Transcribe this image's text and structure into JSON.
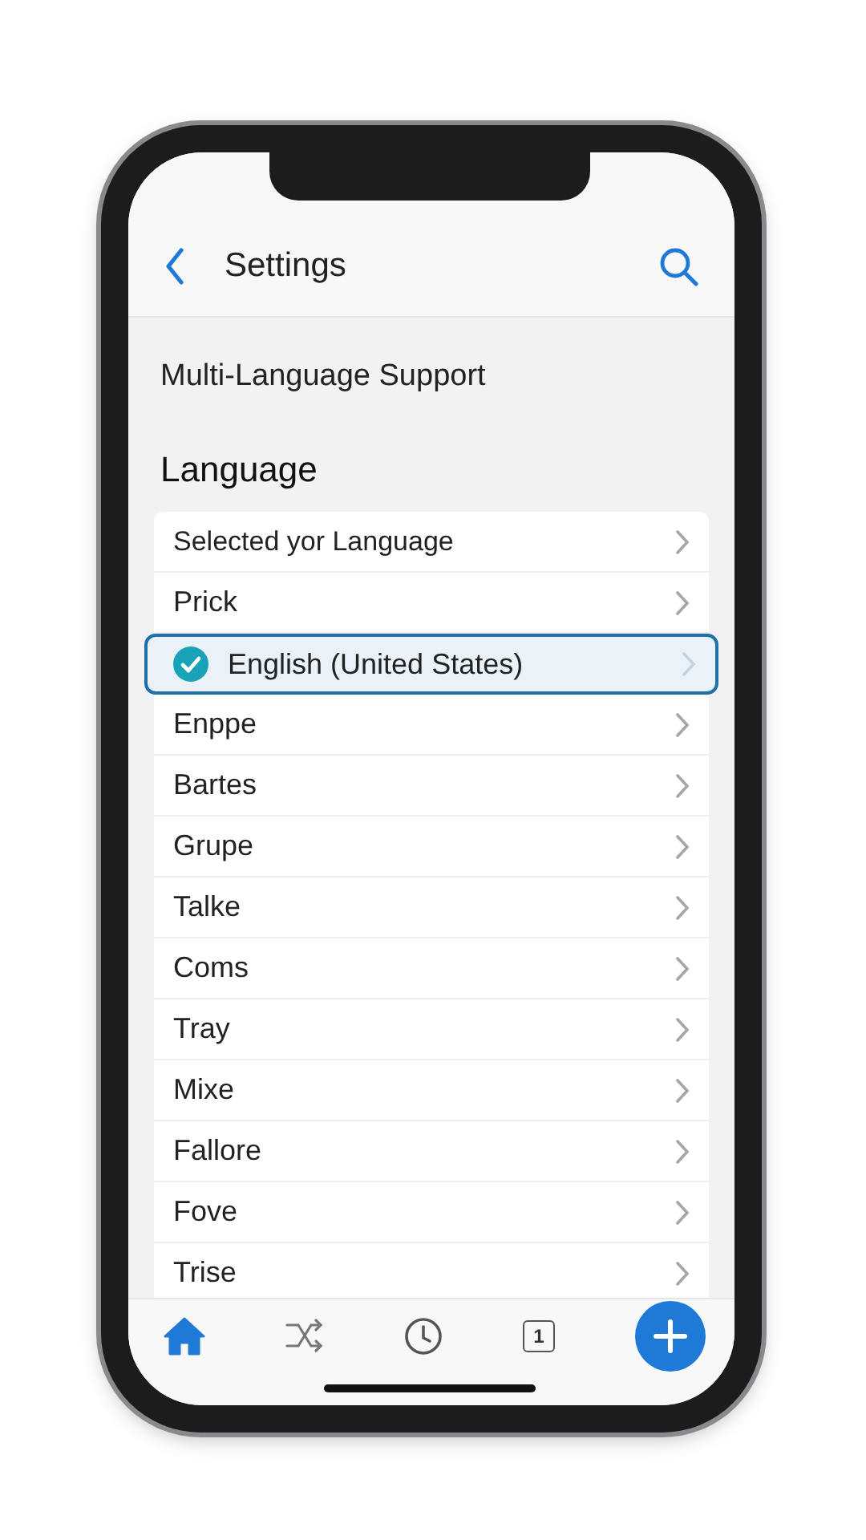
{
  "nav": {
    "title": "Settings"
  },
  "section_title": "Multi-Language Support",
  "list_heading": "Language",
  "languages": [
    {
      "label": "Selected yor Language",
      "selected": false
    },
    {
      "label": "Prick",
      "selected": false
    },
    {
      "label": "English (United States)",
      "selected": true
    },
    {
      "label": "Enppe",
      "selected": false
    },
    {
      "label": "Bartes",
      "selected": false
    },
    {
      "label": "Grupe",
      "selected": false
    },
    {
      "label": "Talke",
      "selected": false
    },
    {
      "label": "Coms",
      "selected": false
    },
    {
      "label": "Tray",
      "selected": false
    },
    {
      "label": "Mixe",
      "selected": false
    },
    {
      "label": "Fallore",
      "selected": false
    },
    {
      "label": "Fove",
      "selected": false
    },
    {
      "label": "Trise",
      "selected": false
    }
  ],
  "tab_bar": [
    {
      "kind": "home",
      "selected": true
    },
    {
      "kind": "shuffle",
      "selected": false
    },
    {
      "kind": "clock",
      "selected": false
    },
    {
      "kind": "calendar",
      "selected": false,
      "glyph": "1"
    },
    {
      "kind": "add",
      "selected": false
    }
  ]
}
